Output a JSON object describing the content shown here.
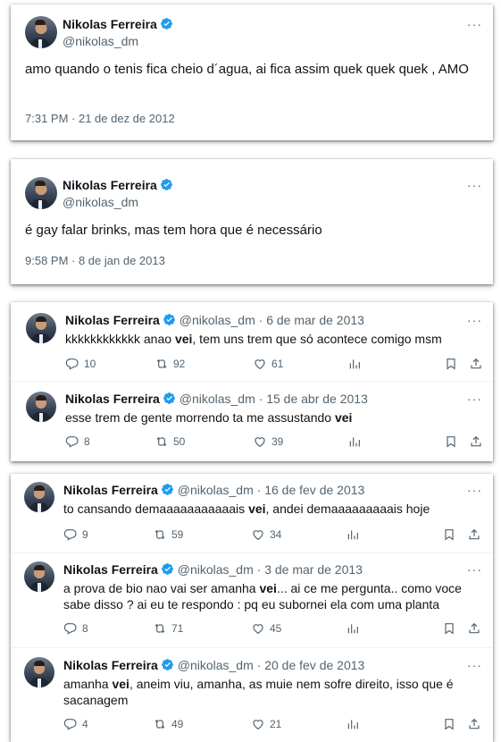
{
  "user": {
    "name": "Nikolas Ferreira",
    "handle": "@nikolas_dm"
  },
  "more_label": "···",
  "big_tweets": [
    {
      "text": "amo quando o tenis fica cheio d´agua, ai fica assim quek quek quek , AMO",
      "time": "7:31 PM · 21 de dez de 2012"
    },
    {
      "text": "é gay falar brinks, mas tem hora que é necessário",
      "time": "9:58 PM · 8 de jan de 2013"
    }
  ],
  "rows": [
    {
      "date": "@nikolas_dm · 6 de mar de 2013",
      "text_before": "kkkkkkkkkkkk anao ",
      "bold": "vei",
      "text_after": ", tem uns trem que só acontece comigo msm",
      "replies": "10",
      "retweets": "92",
      "likes": "61"
    },
    {
      "date": "@nikolas_dm · 15 de abr de 2013",
      "text_before": "esse trem de gente morrendo ta me assustando ",
      "bold": "vei",
      "text_after": "",
      "replies": "8",
      "retweets": "50",
      "likes": "39"
    },
    {
      "date": "@nikolas_dm · 16 de fev de 2013",
      "text_before": "to cansando demaaaaaaaaaaais ",
      "bold": "vei",
      "text_after": ", andei demaaaaaaaaais hoje",
      "replies": "9",
      "retweets": "59",
      "likes": "34"
    },
    {
      "date": "@nikolas_dm · 3 de mar de 2013",
      "text_before": "a prova de bio nao vai ser amanha ",
      "bold": "vei",
      "text_after": "... ai ce me pergunta.. como voce sabe disso ? ai eu te respondo : pq eu subornei ela com uma planta",
      "replies": "8",
      "retweets": "71",
      "likes": "45"
    },
    {
      "date": "@nikolas_dm · 20 de fev de 2013",
      "text_before": "amanha ",
      "bold": "vei",
      "text_after": ", aneim viu, amanha, as muie nem sofre direito, isso que é sacanagem",
      "replies": "4",
      "retweets": "49",
      "likes": "21"
    }
  ],
  "colors": {
    "verified": "#1d9bf0",
    "text": "#0f1419",
    "secondary": "#536471"
  }
}
